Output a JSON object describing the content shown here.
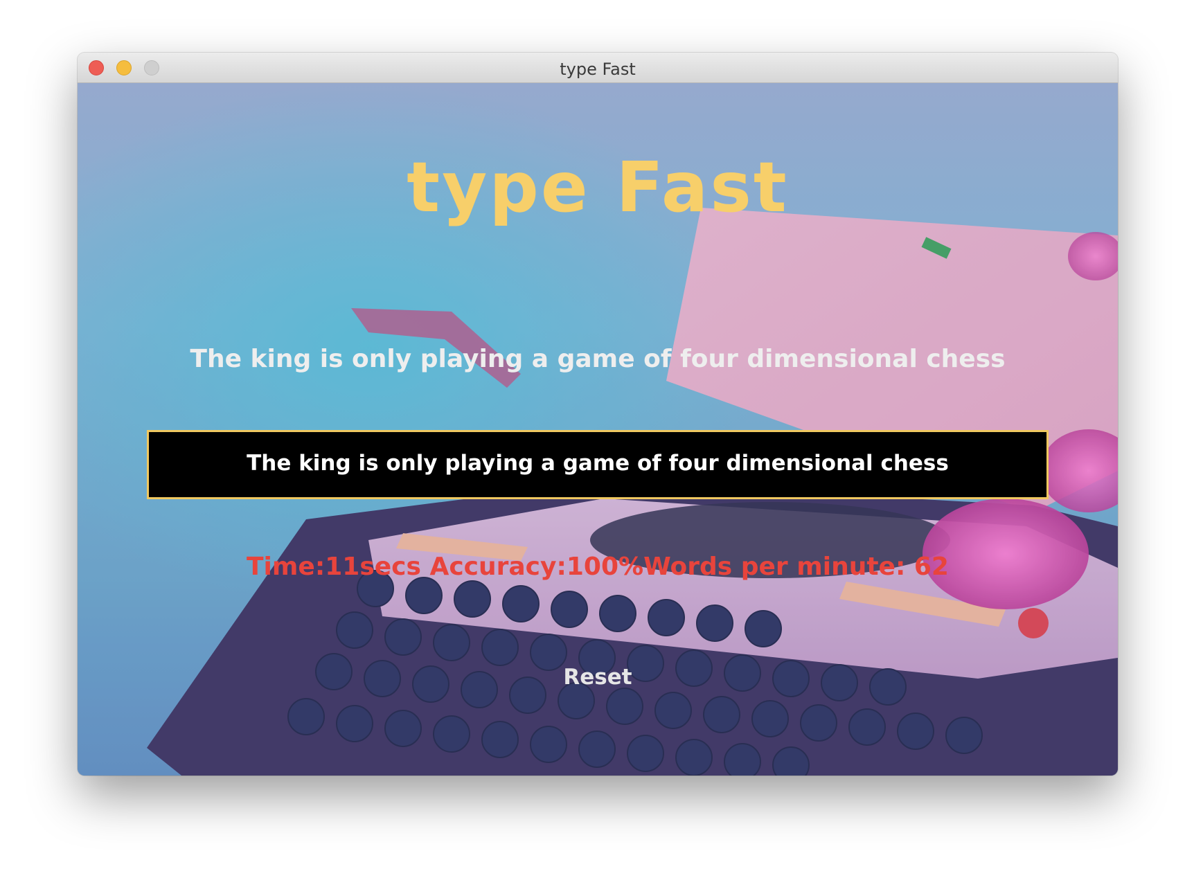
{
  "window": {
    "title": "type Fast"
  },
  "game": {
    "title": "type Fast",
    "prompt_sentence": "The king is only playing a game of four dimensional chess",
    "typed_text": "The king is only playing a game of four dimensional chess",
    "stats": "Time:11secs Accuracy:100%Words per minute: 62",
    "reset_label": "Reset"
  },
  "colors": {
    "title": "#f7cf6a",
    "prompt": "#eeeeee",
    "input_bg": "#000000",
    "input_border": "#f0c860",
    "stats": "#e8443c",
    "reset": "#e6e6e6"
  },
  "background": {
    "description_icon": "typewriter-photo"
  }
}
